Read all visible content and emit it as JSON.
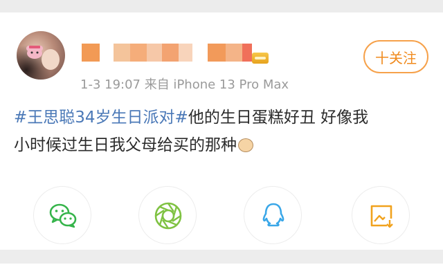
{
  "post": {
    "meta": "1-3 19:07  来自 iPhone 13 Pro Max",
    "follow_label": "十关注",
    "hashtag": "#王思聪34岁生日派对#",
    "text_line1_rest": "他的生日蛋糕好丑 好像我",
    "text_line2": "小时候过生日我父母给买的那种"
  },
  "share_icons": [
    "wechat-icon",
    "moments-icon",
    "qq-icon",
    "save-image-icon"
  ],
  "colors": {
    "accent": "#f08a1d",
    "hashtag": "#4a78b7",
    "wechat": "#35b44a",
    "moments": "#7fc242",
    "qq": "#3aa7e8",
    "save": "#f1a21d"
  }
}
